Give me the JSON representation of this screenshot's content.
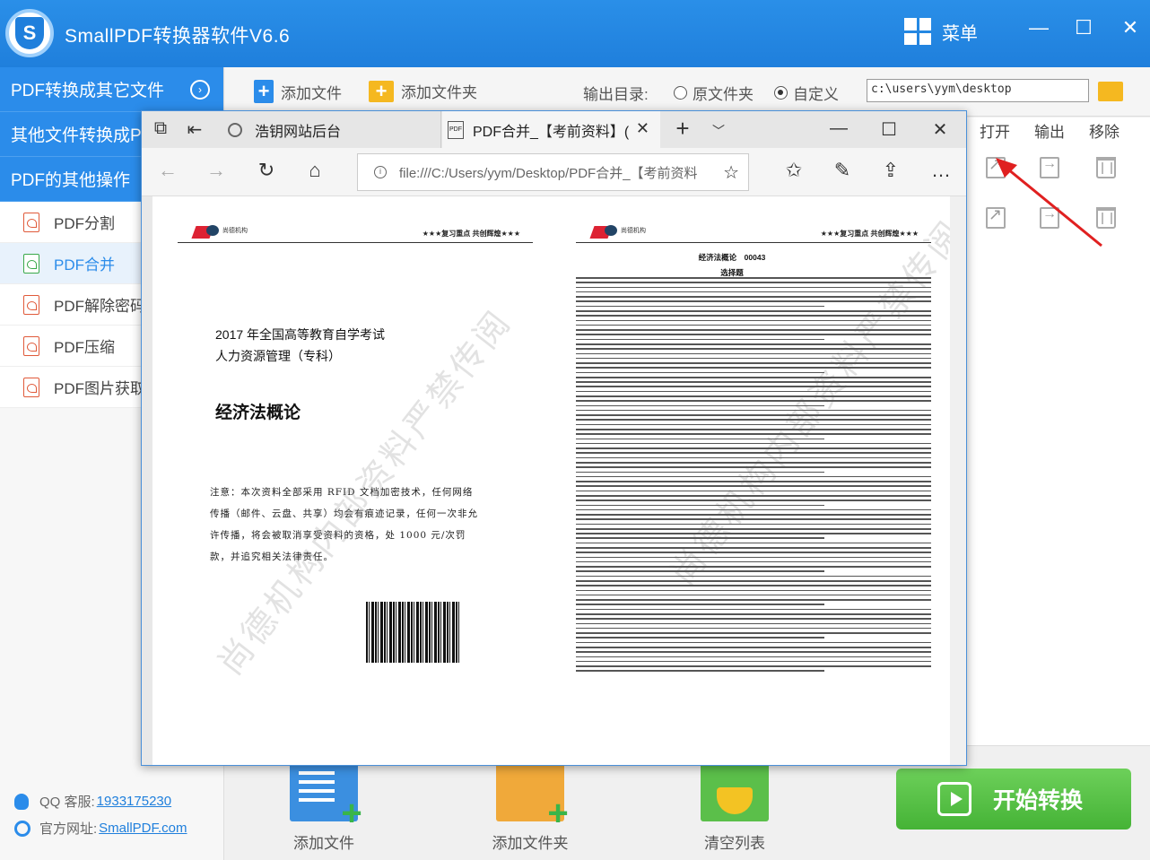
{
  "app": {
    "title": "SmallPDF转换器软件V6.6",
    "menu_label": "菜单",
    "minimize": "—",
    "maximize": "☐",
    "close": "✕"
  },
  "sidebar": {
    "sections": [
      {
        "label": "PDF转换成其它文件"
      },
      {
        "label": "其他文件转换成PDF"
      },
      {
        "label": "PDF的其他操作"
      }
    ],
    "items": [
      {
        "label": "PDF分割"
      },
      {
        "label": "PDF合并"
      },
      {
        "label": "PDF解除密码"
      },
      {
        "label": "PDF压缩"
      },
      {
        "label": "PDF图片获取"
      }
    ],
    "qq_label": "QQ 客服:",
    "qq_value": "1933175230",
    "site_label": "官方网址:",
    "site_value": "SmallPDF.com"
  },
  "toolbar": {
    "add_file": "添加文件",
    "add_folder": "添加文件夹",
    "output_label": "输出目录:",
    "option_source": "原文件夹",
    "option_custom": "自定义",
    "output_path": "c:\\users\\yym\\desktop"
  },
  "list": {
    "col_open": "打开",
    "col_output": "输出",
    "col_remove": "移除"
  },
  "bottom": {
    "add_file": "添加文件",
    "add_folder": "添加文件夹",
    "clear_list": "清空列表",
    "start": "开始转换"
  },
  "browser": {
    "tab1_title": "浩钥网站后台",
    "tab2_title": "PDF合并_【考前资料】(",
    "tab_close": "✕",
    "new_tab": "+",
    "address": "file:///C:/Users/yym/Desktop/PDF合并_【考前资料",
    "win_min": "—",
    "win_max": "☐",
    "win_close": "✕"
  },
  "pdf": {
    "header_tag": "★★★复习重点 共创辉煌★★★",
    "logo_text": "尚德机构",
    "cover_line1": "2017 年全国高等教育自学考试",
    "cover_line2": "人力资源管理（专科）",
    "cover_title": "经济法概论",
    "cover_note": "注意：本次资料全部采用 RFID 文档加密技术，任何网络传播（邮件、云盘、共享）均会有痕迹记录，任何一次非允许传播，将会被取消享受资料的资格，处 1000 元/次罚款，并追究相关法律责任。",
    "watermark": "尚德机构内部资料严禁传阅",
    "page2_title": "经济法概论　00043",
    "page2_subtitle": "选择题"
  }
}
